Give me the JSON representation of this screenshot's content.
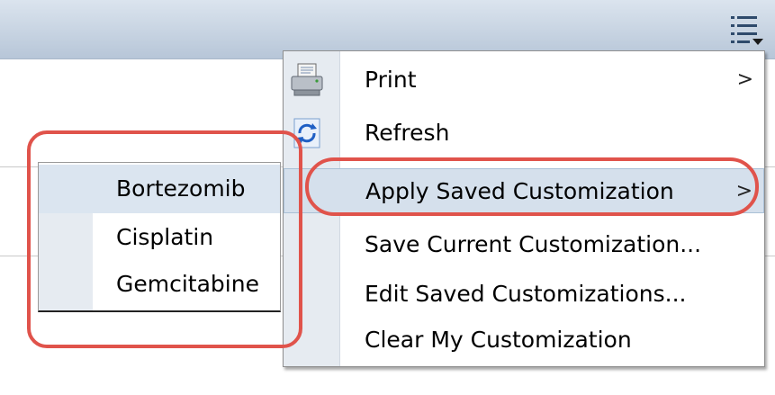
{
  "menu": {
    "items": [
      {
        "label": "Print",
        "has_submenu": true,
        "icon": "printer-icon"
      },
      {
        "label": "Refresh",
        "has_submenu": false,
        "icon": "refresh-icon"
      },
      {
        "label": "Apply Saved Customization",
        "has_submenu": true,
        "highlighted": true
      },
      {
        "label": "Save Current Customization...",
        "has_submenu": false
      },
      {
        "label": "Edit Saved Customizations...",
        "has_submenu": false
      },
      {
        "label": "Clear My Customization",
        "has_submenu": false
      }
    ],
    "submenu_arrow": ">"
  },
  "submenu": {
    "items": [
      {
        "label": "Bortezomib",
        "highlighted": true
      },
      {
        "label": "Cisplatin"
      },
      {
        "label": "Gemcitabine"
      }
    ]
  },
  "toolbar": {
    "icon": "list-options-icon"
  },
  "colors": {
    "toolbar": "#c5d2e1",
    "menu_gutter": "#e6ebf1",
    "highlight": "#d5e0ec",
    "annotation": "#e0534b"
  }
}
